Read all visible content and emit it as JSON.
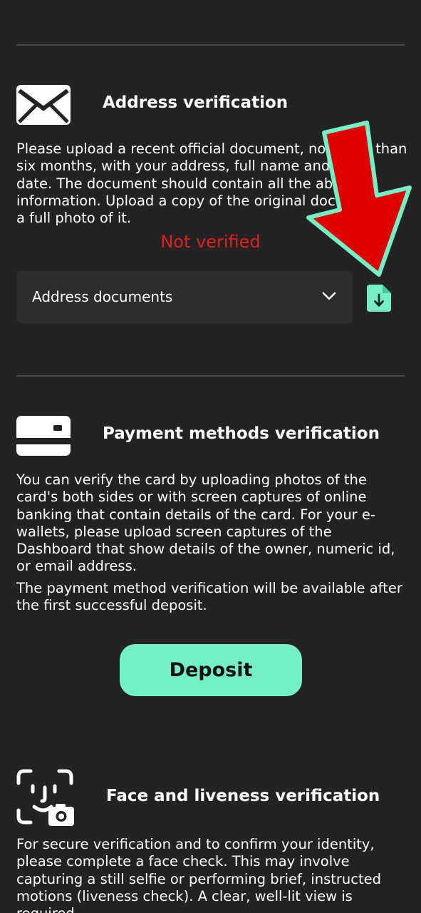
{
  "address_section": {
    "title": "Address verification",
    "description": "Please upload a recent official document, not older than six months, with your address, full name and issue date. The document should contain all the above information. Upload a copy of the original document or a full photo of it.",
    "status": "Not verified",
    "status_color": "#e21e1e",
    "document_select": {
      "selected": "Address documents"
    },
    "icon": "envelope-icon"
  },
  "payment_section": {
    "title": "Payment methods verification",
    "description": "You can verify the card by uploading photos of the card's both sides or with screen captures of online banking that contain details of the card. For your e-wallets, please upload screen captures of the Dashboard that show details of the owner, numeric id, or email address.",
    "note": "The payment method verification will be available after the first successful deposit.",
    "deposit_label": "Deposit",
    "icon": "credit-card-icon"
  },
  "face_section": {
    "title": "Face and liveness verification",
    "description": "For secure verification and to confirm your identity, please complete a face check. This may involve capturing a still selfie or performing brief, instructed motions (liveness check). A clear, well-lit view is required.",
    "icon": "face-scan-camera-icon"
  },
  "colors": {
    "background": "#232323",
    "accent": "#73f0c5",
    "annotation_arrow": "#e00000"
  }
}
